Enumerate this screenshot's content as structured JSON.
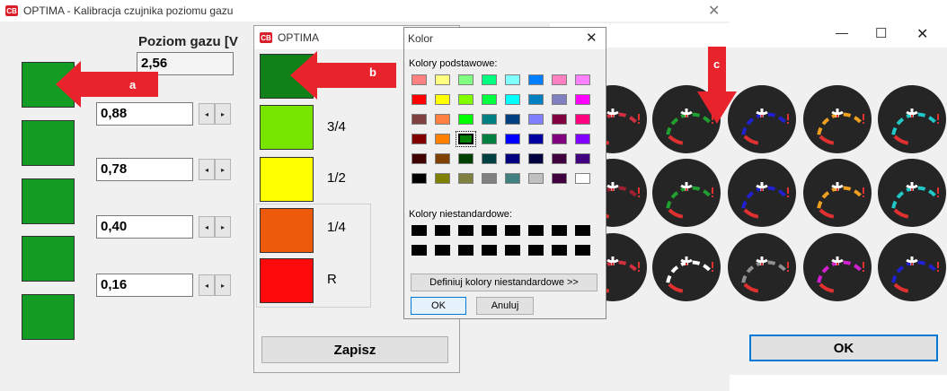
{
  "main_window": {
    "title": "OPTIMA - Kalibracja czujnika poziomu gazu",
    "close_glyph": "✕",
    "heading": "Poziom gazu [V",
    "current_value": "2,56",
    "rows": [
      {
        "value": "0,88"
      },
      {
        "value": "0,78"
      },
      {
        "value": "0,40"
      },
      {
        "value": "0,16"
      }
    ],
    "spin_left": "◂",
    "spin_right": "▸",
    "annotation": "a",
    "green_color": "#139c23"
  },
  "optima_dialog": {
    "title": "OPTIMA",
    "levels": [
      {
        "label": "",
        "color": "#108019"
      },
      {
        "label": "3/4",
        "color": "#76e600"
      },
      {
        "label": "1/2",
        "color": "#ffff00"
      },
      {
        "label": "1/4",
        "color": "#ec5a0a"
      },
      {
        "label": "R",
        "color": "#ff0a0a"
      }
    ],
    "save_button": "Zapisz",
    "annotation": "b"
  },
  "kolor_dialog": {
    "title": "Kolor",
    "close_glyph": "✕",
    "basic_label": "Kolory podstawowe:",
    "custom_label": "Kolory niestandardowe:",
    "define_button": "Definiuj kolory niestandardowe >>",
    "ok_button": "OK",
    "cancel_button": "Anuluj",
    "selected_index": 26,
    "basic_colors": [
      "#ff8080",
      "#ffff80",
      "#80ff80",
      "#00ff80",
      "#80ffff",
      "#0080ff",
      "#ff80c0",
      "#ff80ff",
      "#ff0000",
      "#ffff00",
      "#80ff00",
      "#00ff40",
      "#00ffff",
      "#0080c0",
      "#8080c0",
      "#ff00ff",
      "#804040",
      "#ff8040",
      "#00ff00",
      "#008080",
      "#004080",
      "#8080ff",
      "#800040",
      "#ff0080",
      "#800000",
      "#ff8000",
      "#008000",
      "#008040",
      "#0000ff",
      "#0000a0",
      "#800080",
      "#8000ff",
      "#400000",
      "#804000",
      "#004000",
      "#004040",
      "#000080",
      "#000040",
      "#400040",
      "#400080",
      "#000000",
      "#808000",
      "#808040",
      "#808080",
      "#408080",
      "#c0c0c0",
      "#400040",
      "#ffffff"
    ],
    "custom_colors_count": 16
  },
  "gauges_window": {
    "minimize_glyph": "—",
    "maximize_glyph": "☐",
    "close_glyph": "✕",
    "ok_button": "OK",
    "annotation": "c",
    "gauge_accents": [
      [
        "#d03040",
        "#20a030",
        "#2020d0",
        "#f0a020",
        "#20c8c8"
      ],
      [
        "#a02030",
        "#20a030",
        "#2020d0",
        "#f0a020",
        "#20c8c8"
      ],
      [
        "#d03040",
        "#ffffff",
        "#909090",
        "#d020d0",
        "#2020d0"
      ]
    ]
  }
}
